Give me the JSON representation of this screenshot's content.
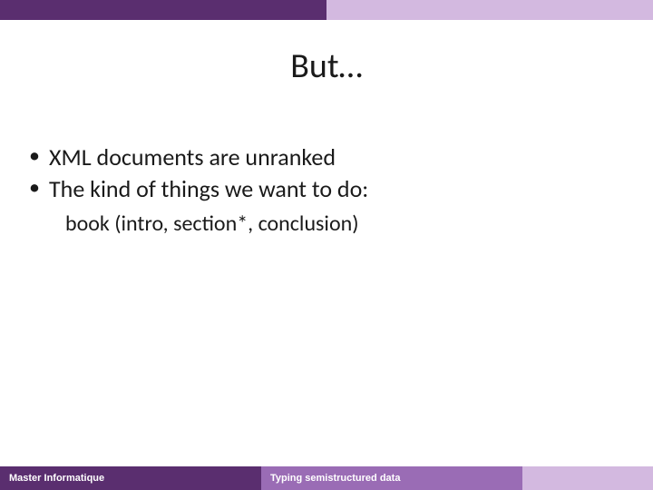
{
  "title": "But…",
  "bullets": [
    "XML documents are unranked",
    "The kind of things we want to do:"
  ],
  "subline": "book (intro, section*, conclusion)",
  "footer": {
    "left": "Master Informatique",
    "center": "Typing semistructured data",
    "right": ""
  }
}
